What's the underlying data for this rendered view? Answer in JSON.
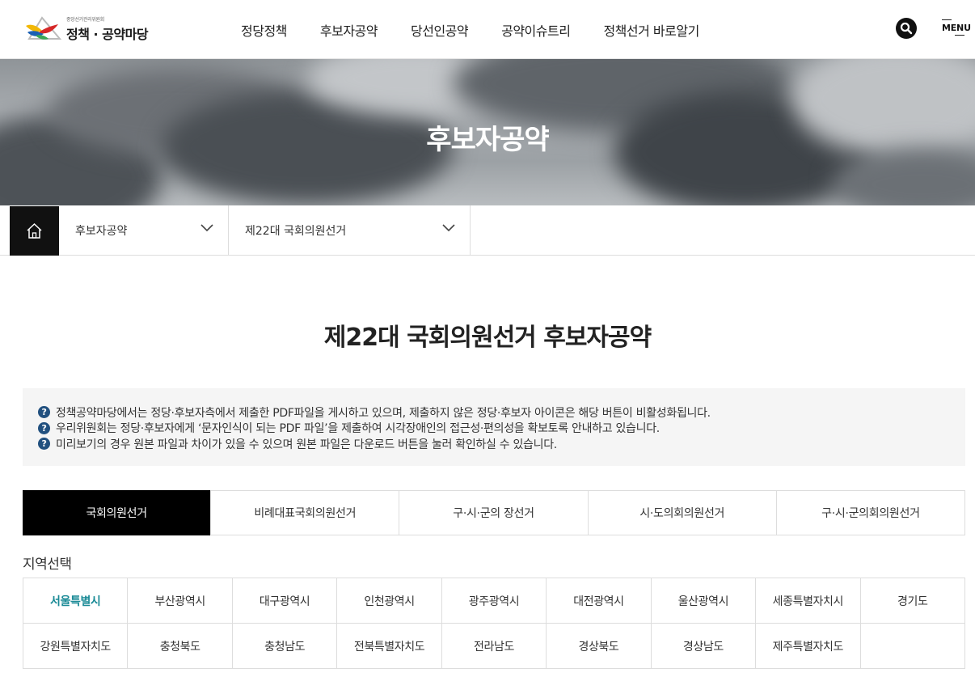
{
  "header": {
    "logo_sub": "중앙선거관리위원회",
    "logo_main": "정책 · 공약마당",
    "nav": [
      "정당정책",
      "후보자공약",
      "당선인공약",
      "공약이슈트리",
      "정책선거 바로알기"
    ],
    "search_icon": "search-icon",
    "menu_label": "MENU"
  },
  "hero": {
    "title": "후보자공약"
  },
  "breadcrumb": {
    "home_icon": "home-icon",
    "first": "후보자공약",
    "second": "제22대 국회의원선거"
  },
  "page_title": "제22대 국회의원선거 후보자공약",
  "notice": {
    "icon": "question-icon",
    "lines": [
      "정책공약마당에서는 정당·후보자측에서 제출한 PDF파일을 게시하고 있으며, 제출하지 않은 정당·후보자 아이콘은 해당 버튼이 비활성화됩니다.",
      "우리위원회는 정당·후보자에게 ‘문자인식이 되는 PDF 파일’을 제출하여 시각장애인의 접근성·편의성을 확보토록 안내하고 있습니다.",
      "미리보기의 경우 원본 파일과 차이가 있을 수 있으며 원본 파일은 다운로드 버튼을 눌러 확인하실 수 있습니다."
    ]
  },
  "tabs": [
    "국회의원선거",
    "비례대표국회의원선거",
    "구·시·군의 장선거",
    "시·도의회의원선거",
    "구·시·군의회의원선거"
  ],
  "active_tab": "국회의원선거",
  "region_label": "지역선택",
  "regions": [
    "서울특별시",
    "부산광역시",
    "대구광역시",
    "인천광역시",
    "광주광역시",
    "대전광역시",
    "울산광역시",
    "세종특별자치시",
    "경기도",
    "강원특별자치도",
    "충청북도",
    "충청남도",
    "전북특별자치도",
    "전라남도",
    "경상북도",
    "경상남도",
    "제주특별자치도",
    ""
  ],
  "active_region": "서울특별시",
  "colors": {
    "active_region": "#1a8a96",
    "notice_icon": "#21507f",
    "active_tab_bg": "#000000"
  }
}
